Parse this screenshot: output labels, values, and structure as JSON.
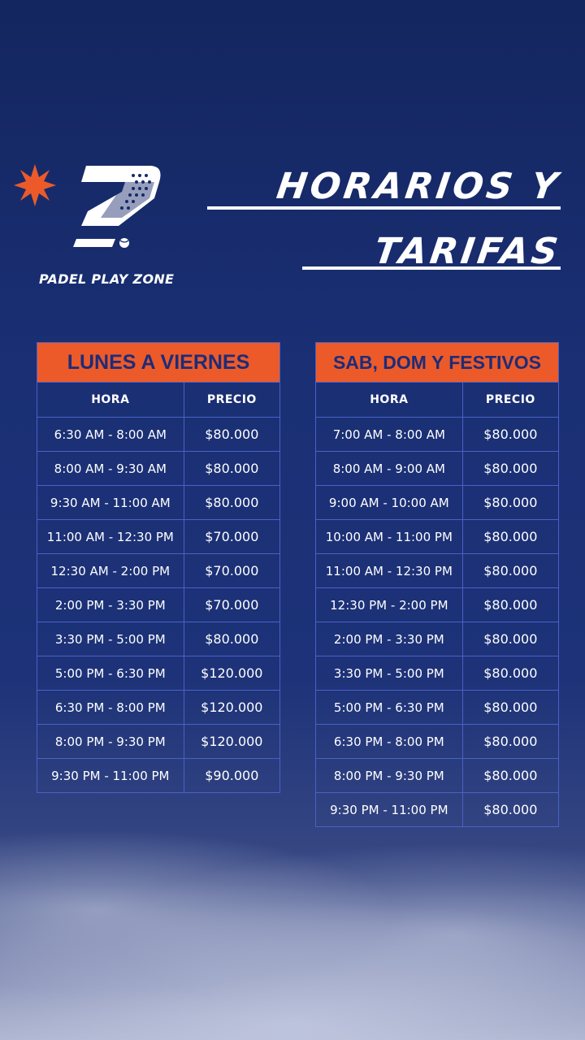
{
  "brand": "PADEL PLAY ZONE",
  "title": {
    "line1": "HORARIOS Y",
    "line2": "TARIFAS"
  },
  "colors": {
    "background": "#16296a",
    "accent": "#ec5a2a",
    "grid": "#4a61c7",
    "header_text": "#1d2c78"
  },
  "icons": [
    "star-burst-icon",
    "logo-7-icon",
    "padel-ball-icon"
  ],
  "weekday": {
    "title": "LUNES A VIERNES",
    "col_hora": "HORA",
    "col_precio": "PRECIO",
    "rows": [
      {
        "hora": "6:30 AM - 8:00 AM",
        "precio": "$80.000"
      },
      {
        "hora": "8:00 AM - 9:30 AM",
        "precio": "$80.000"
      },
      {
        "hora": "9:30 AM - 11:00 AM",
        "precio": "$80.000"
      },
      {
        "hora": "11:00 AM - 12:30 PM",
        "precio": "$70.000"
      },
      {
        "hora": "12:30 AM - 2:00 PM",
        "precio": "$70.000"
      },
      {
        "hora": "2:00 PM - 3:30 PM",
        "precio": "$70.000"
      },
      {
        "hora": "3:30 PM - 5:00 PM",
        "precio": "$80.000"
      },
      {
        "hora": "5:00 PM - 6:30 PM",
        "precio": "$120.000"
      },
      {
        "hora": "6:30 PM - 8:00 PM",
        "precio": "$120.000"
      },
      {
        "hora": "8:00 PM - 9:30 PM",
        "precio": "$120.000"
      },
      {
        "hora": "9:30 PM - 11:00 PM",
        "precio": "$90.000"
      }
    ]
  },
  "weekend": {
    "title": "SAB, DOM Y FESTIVOS",
    "col_hora": "HORA",
    "col_precio": "PRECIO",
    "rows": [
      {
        "hora": "7:00 AM - 8:00 AM",
        "precio": "$80.000"
      },
      {
        "hora": "8:00 AM - 9:00 AM",
        "precio": "$80.000"
      },
      {
        "hora": "9:00 AM - 10:00 AM",
        "precio": "$80.000"
      },
      {
        "hora": "10:00 AM - 11:00 PM",
        "precio": "$80.000"
      },
      {
        "hora": "11:00 AM - 12:30 PM",
        "precio": "$80.000"
      },
      {
        "hora": "12:30 PM - 2:00 PM",
        "precio": "$80.000"
      },
      {
        "hora": "2:00 PM - 3:30 PM",
        "precio": "$80.000"
      },
      {
        "hora": "3:30 PM - 5:00 PM",
        "precio": "$80.000"
      },
      {
        "hora": "5:00 PM - 6:30 PM",
        "precio": "$80.000"
      },
      {
        "hora": "6:30 PM - 8:00 PM",
        "precio": "$80.000"
      },
      {
        "hora": "8:00 PM - 9:30 PM",
        "precio": "$80.000"
      },
      {
        "hora": "9:30 PM - 11:00 PM",
        "precio": "$80.000"
      }
    ]
  }
}
